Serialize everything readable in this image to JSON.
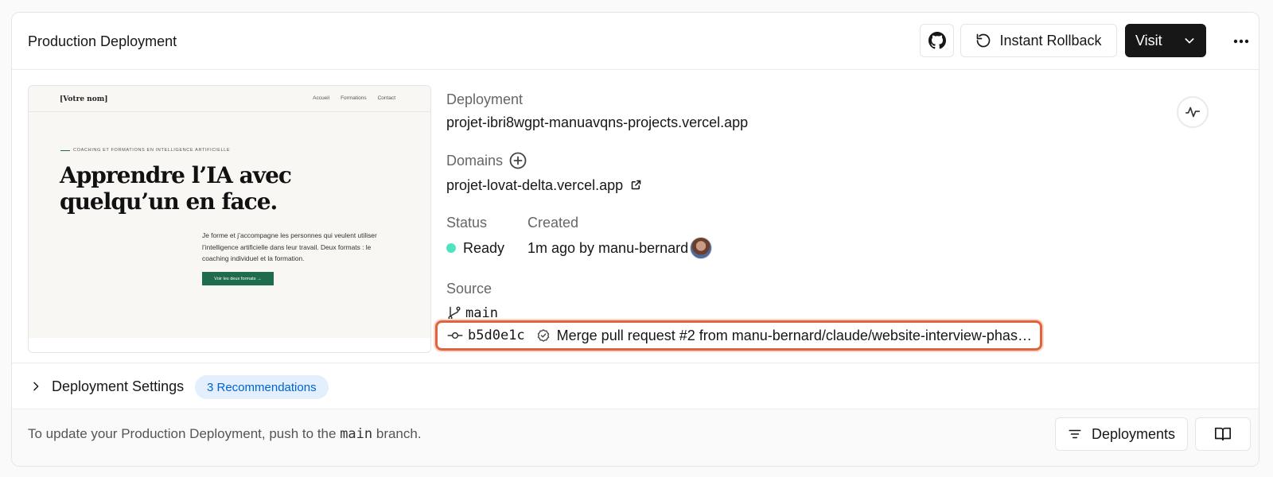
{
  "header": {
    "title": "Production Deployment",
    "rollback_label": "Instant Rollback",
    "visit_label": "Visit"
  },
  "preview": {
    "brand": "[Votre nom]",
    "nav": [
      "Accueil",
      "Formations",
      "Contact"
    ],
    "eyebrow": "COACHING ET FORMATIONS EN INTELLIGENCE ARTIFICIELLE",
    "headline_line1": "Apprendre l’IA avec",
    "headline_line2": "quelqu’un en face.",
    "paragraph": "Je forme et j’accompagne les personnes qui veulent utiliser l’intelligence artificielle dans leur travail. Deux formats : le coaching individuel et la formation.",
    "cta": "Voir les deux formats →"
  },
  "deployment": {
    "label": "Deployment",
    "url": "projet-ibri8wgpt-manuavqns-projects.vercel.app"
  },
  "domains": {
    "label": "Domains",
    "url": "projet-lovat-delta.vercel.app"
  },
  "status": {
    "label": "Status",
    "value": "Ready",
    "dot_color": "#50e3c2"
  },
  "created": {
    "label": "Created",
    "value": "1m ago by manu-bernard"
  },
  "source": {
    "label": "Source",
    "branch": "main",
    "commit_sha": "b5d0e1c",
    "commit_message": "Merge pull request #2 from manu-bernard/claude/website-interview-phase…"
  },
  "settings": {
    "title": "Deployment Settings",
    "badge": "3 Recommendations"
  },
  "footer": {
    "text_before": "To update your Production Deployment, push to the ",
    "branch": "main",
    "text_after": " branch.",
    "deployments_label": "Deployments"
  },
  "icons": {
    "github": "github-icon",
    "rollback": "rollback-icon",
    "chevron": "chevron-down-icon",
    "more": "more-horizontal-icon",
    "activity": "activity-icon",
    "plus": "plus-circle-icon",
    "external": "external-link-icon",
    "branch": "git-branch-icon",
    "commit": "git-commit-icon",
    "verified": "verified-badge-icon",
    "expand": "chevron-right-icon",
    "filter": "filter-lines-icon",
    "book": "book-open-icon"
  },
  "colors": {
    "highlight": "#e0633f",
    "badge_bg": "#e3effc",
    "badge_text": "#0062d1",
    "accent_green": "#1f6b4e"
  }
}
